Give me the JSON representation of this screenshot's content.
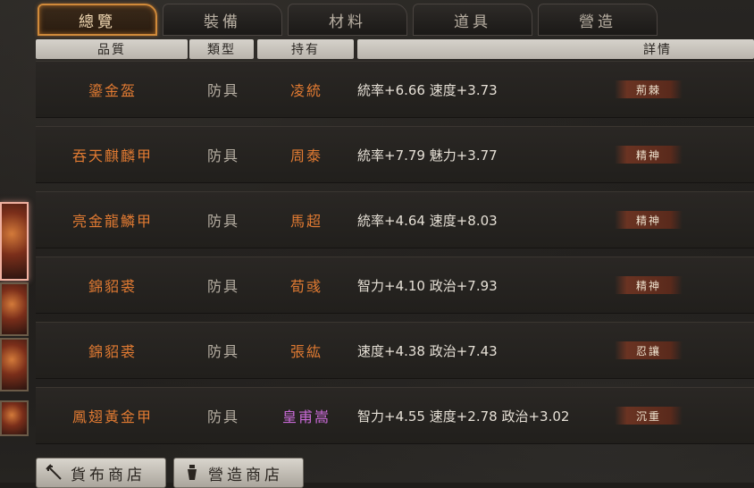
{
  "tabs": [
    {
      "label": "總覽",
      "active": true
    },
    {
      "label": "裝備",
      "active": false
    },
    {
      "label": "材料",
      "active": false
    },
    {
      "label": "道具",
      "active": false
    },
    {
      "label": "營造",
      "active": false
    }
  ],
  "header": {
    "quality": "品質",
    "type": "類型",
    "owner": "持有",
    "details": "詳情"
  },
  "items": [
    {
      "name": "鎏金盔",
      "type": "防具",
      "owner": "凌統",
      "stats": "統率+6.66  速度+3.73",
      "trait": "荊棘"
    },
    {
      "name": "吞天麒麟甲",
      "type": "防具",
      "owner": "周泰",
      "stats": "統率+7.79  魅力+3.77",
      "trait": "精神"
    },
    {
      "name": "亮金龍鱗甲",
      "type": "防具",
      "owner": "馬超",
      "stats": "統率+4.64  速度+8.03",
      "trait": "精神"
    },
    {
      "name": "錦貂裘",
      "type": "防具",
      "owner": "荀彧",
      "stats": "智力+4.10  政治+7.93",
      "trait": "精神"
    },
    {
      "name": "錦貂裘",
      "type": "防具",
      "owner": "張紘",
      "stats": "速度+4.38  政治+7.43",
      "trait": "忍讓"
    },
    {
      "name": "鳳翅黃金甲",
      "type": "防具",
      "owner": "皇甫嵩",
      "stats": "智力+4.55  速度+2.78  政治+3.02",
      "trait": "沉重"
    }
  ],
  "owner_colors": {
    "default": "#e07a32",
    "special": "#c86ad6"
  },
  "buttons": {
    "goods_shop": "貨布商店",
    "build_shop": "營造商店"
  },
  "icons": {
    "goods_shop": "trident-icon",
    "build_shop": "lantern-icon"
  }
}
